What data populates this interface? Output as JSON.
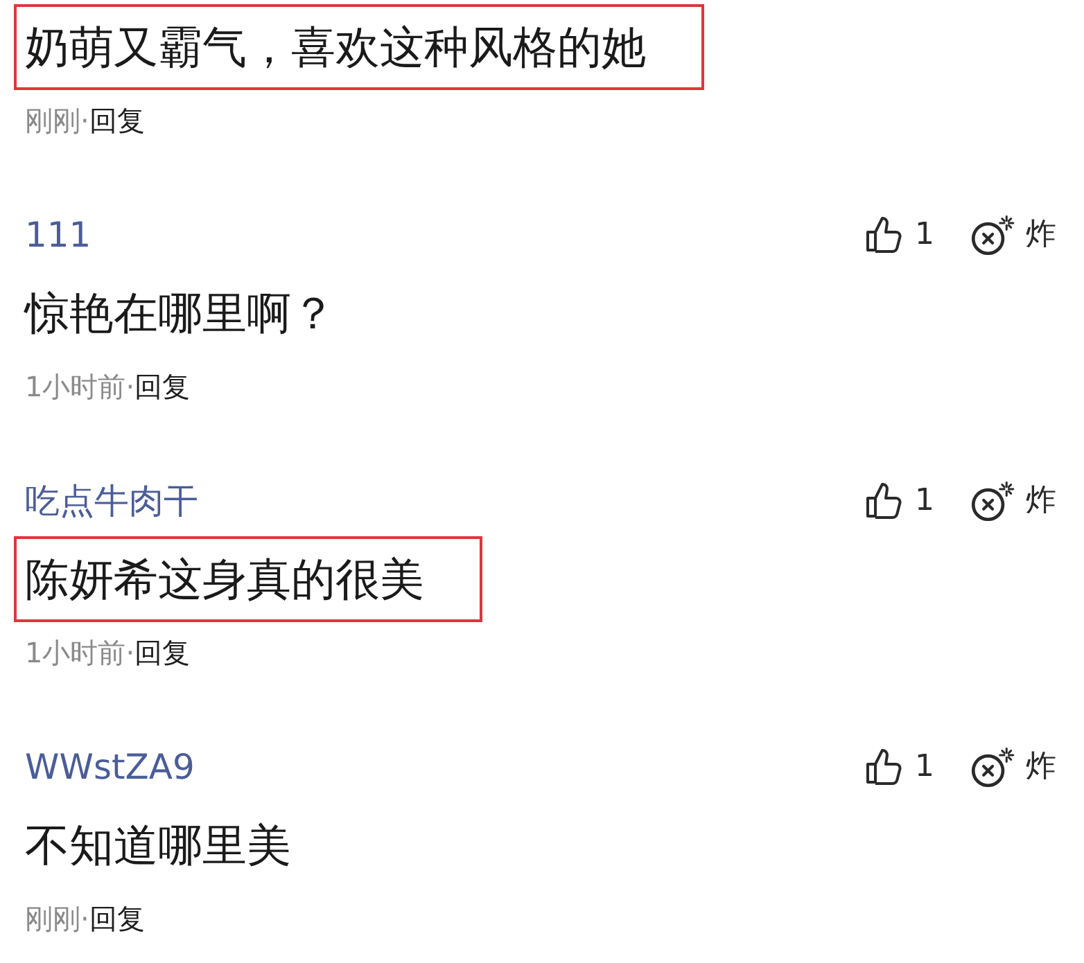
{
  "comments": [
    {
      "text": "奶萌又霸气，喜欢这种风格的她",
      "highlighted": true,
      "time": "刚刚",
      "separator": "·",
      "reply": "回复"
    },
    {
      "username": "111",
      "likes": "1",
      "bomb_label": "炸",
      "text": "惊艳在哪里啊？",
      "highlighted": false,
      "time": "1小时前",
      "separator": "·",
      "reply": "回复"
    },
    {
      "username": "吃点牛肉干",
      "likes": "1",
      "bomb_label": "炸",
      "text": "陈妍希这身真的很美",
      "highlighted": true,
      "time": "1小时前",
      "separator": "·",
      "reply": "回复"
    },
    {
      "username": "WWstZA9",
      "likes": "1",
      "bomb_label": "炸",
      "text": "不知道哪里美",
      "highlighted": false,
      "time": "刚刚",
      "separator": "·",
      "reply": "回复"
    }
  ]
}
